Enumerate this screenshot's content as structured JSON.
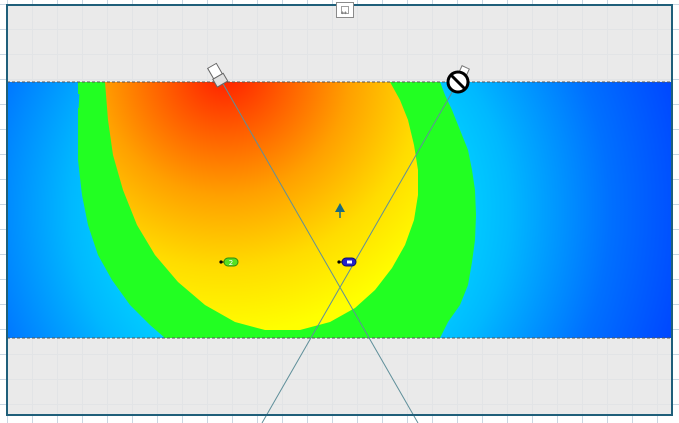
{
  "canvas": {
    "name": "planning-canvas",
    "colors": {
      "room_fill": "#e6e6e6",
      "room_border": "#1f5f7a",
      "grid_line": "#c9d7e3",
      "zone_edge": "#555555",
      "sight_line": "#5f8f9a"
    }
  },
  "heatmap": {
    "description_colors": [
      "#0050ff",
      "#00c8ff",
      "#22ff22",
      "#ffff00",
      "#ff8800",
      "#ff1a00"
    ]
  },
  "devices": {
    "camera": {
      "icon": "camera-icon"
    },
    "blocked": {
      "icon": "no-entry-icon"
    },
    "marker": {
      "icon": "arrow-up-marker-icon",
      "color": "#1a6b80"
    },
    "tag_green": {
      "icon": "green-tag-icon",
      "label": "2",
      "color": "#55e022"
    },
    "tag_blue": {
      "icon": "blue-tag-icon",
      "label": "",
      "color": "#2222cc"
    }
  },
  "handle": {
    "icon": "resize-handle-icon",
    "mark": "↔"
  }
}
